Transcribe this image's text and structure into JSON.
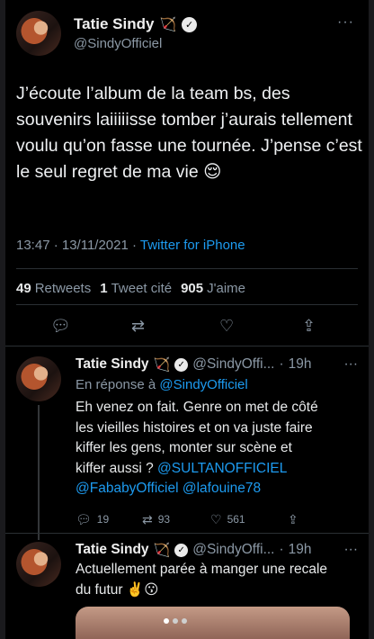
{
  "main_tweet": {
    "author_name": "Tatie Sindy",
    "author_glyphs": "🏹",
    "handle": "@SindyOfficiel",
    "text": "J’écoute l’album de la team bs, des souvenirs laiiiiisse tomber j’aurais tellement voulu qu’on fasse une tournée. J’pense c’est le seul regret de ma vie 😌",
    "time": "13:47 · 13/11/2021 · ",
    "source": "Twitter for iPhone",
    "retweets_count": "49",
    "retweets_label": "Retweets",
    "quotes_count": "1",
    "quotes_label": "Tweet cité",
    "likes_count": "905",
    "likes_label": "J'aime",
    "more": "···"
  },
  "icons": {
    "reply": "reply-icon",
    "retweet": "retweet-icon",
    "like": "heart-icon",
    "share": "share-icon",
    "verified": "verified-icon"
  },
  "replies": [
    {
      "author_name": "Tatie Sindy",
      "handle": "@SindyOffi...",
      "time": "19h",
      "reply_to_prefix": "En réponse à",
      "reply_to": "@SindyOfficiel",
      "text_lines": [
        "Eh venez on fait. Genre on met de côté",
        "les vieilles histoires et on va juste faire",
        "kiffer les gens, monter sur scène et",
        "kiffer aussi ?"
      ],
      "mention_inline": "@SULTANOFFICIEL",
      "mentions": [
        "@FababyOfficiel",
        "@lafouine78"
      ],
      "reply_count": "19",
      "retweet_count": "93",
      "like_count": "561"
    },
    {
      "author_name": "Tatie Sindy",
      "handle": "@SindyOffi...",
      "time": "19h",
      "text_lines": [
        "Actuellement parée à manger une recale",
        "du futur ✌️😗"
      ]
    }
  ],
  "colors": {
    "background": "#000000",
    "link": "#1d9bf0",
    "muted": "#8b98a5",
    "text": "#e7e9ea"
  }
}
